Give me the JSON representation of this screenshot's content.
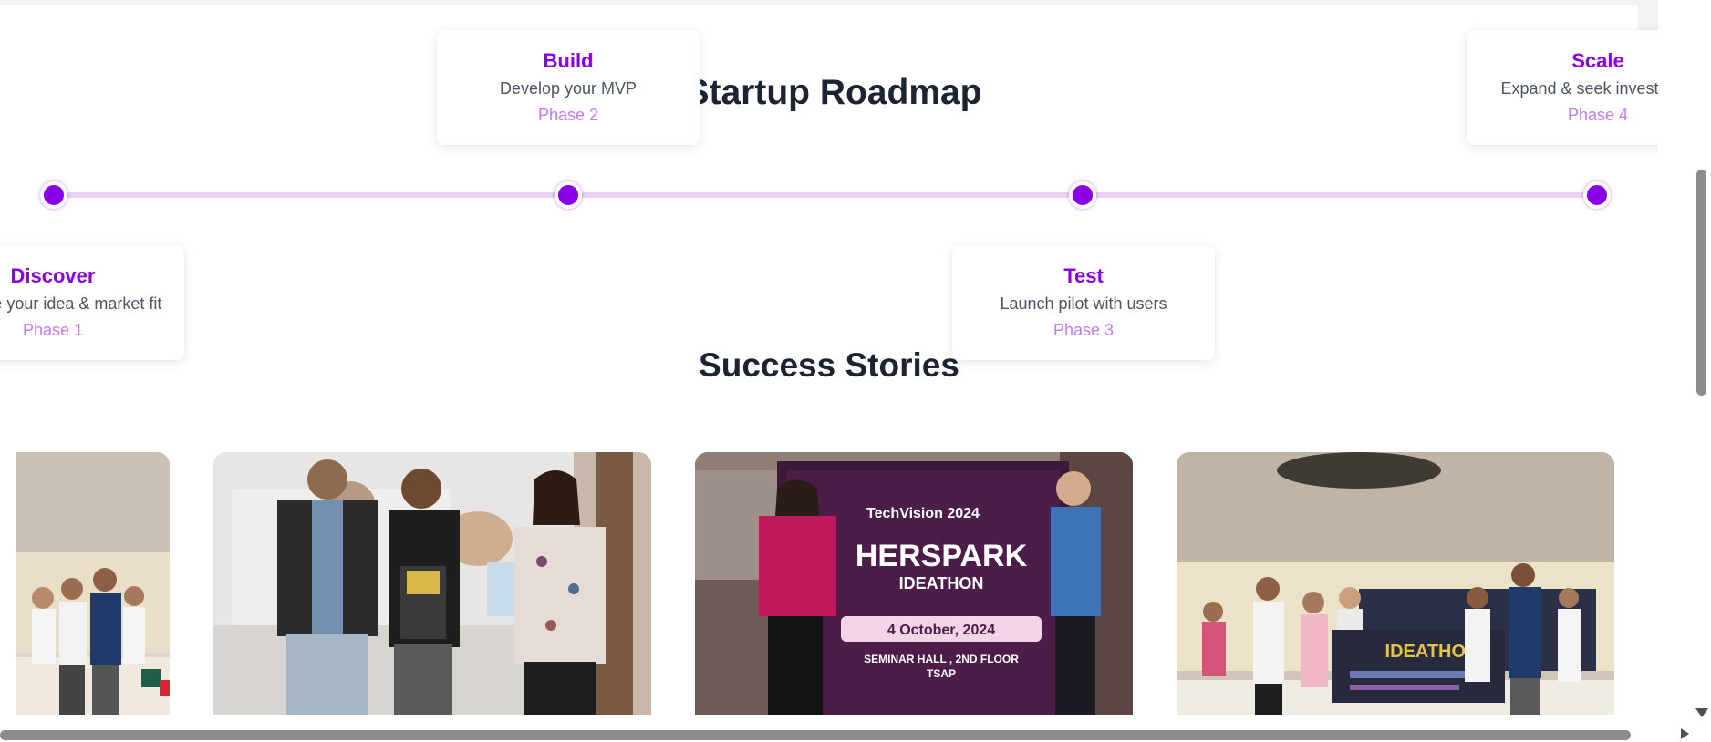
{
  "roadmap": {
    "title": "Startup Roadmap",
    "phases": [
      {
        "title": "Discover",
        "description": "Validate your idea & market fit",
        "phase": "Phase 1"
      },
      {
        "title": "Build",
        "description": "Develop your MVP",
        "phase": "Phase 2"
      },
      {
        "title": "Test",
        "description": "Launch pilot with users",
        "phase": "Phase 3"
      },
      {
        "title": "Scale",
        "description": "Expand & seek investment",
        "phase": "Phase 4"
      }
    ]
  },
  "stories": {
    "title": "Success Stories",
    "photos": [
      {
        "description": "Award presentation group photo (partially visible)"
      },
      {
        "description": "Three people holding a certificate"
      },
      {
        "description": "Two participants beside TechVision 2024 HerSpark Ideathon banner",
        "banner_lines": [
          "TechVision 2024",
          "HERSPARK",
          "IDEATHON",
          "4 October, 2024",
          "SEMINAR HALL , 2ND FLOOR",
          "TSAP"
        ]
      },
      {
        "description": "Ideathon winners holding a large cheque",
        "cheque_text": "IDEATHON"
      }
    ]
  },
  "colors": {
    "accent": "#8a00e6",
    "accent_light": "#c47bf0",
    "track": "#ead3f7",
    "heading": "#1c2434",
    "body_text": "#4b5563"
  }
}
